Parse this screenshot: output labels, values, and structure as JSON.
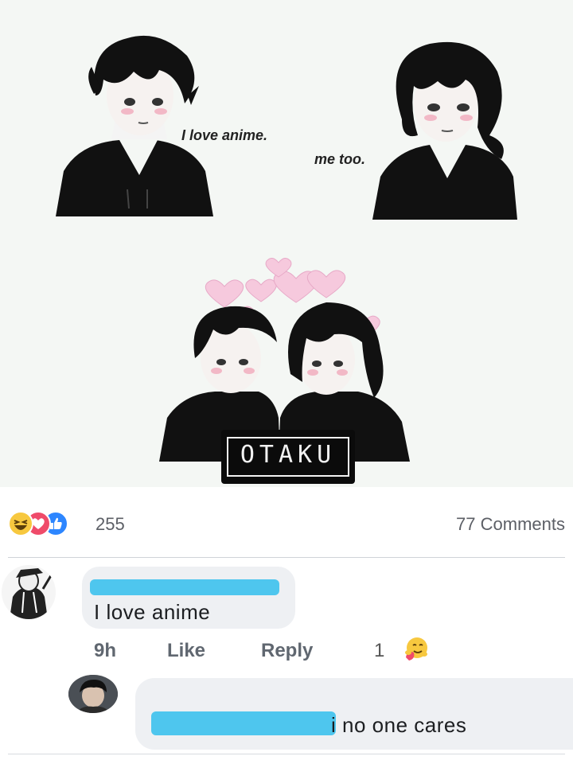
{
  "comic": {
    "speech_left": "I love anime.",
    "speech_right": "me too.",
    "logo_text": "OTAKU"
  },
  "reactions": {
    "icons": [
      "haha-icon",
      "love-icon",
      "like-icon"
    ],
    "count": "255",
    "comments": "77 Comments"
  },
  "comments": [
    {
      "text": "I love anime",
      "time": "9h",
      "like": "Like",
      "reply": "Reply",
      "reaction_count": "1",
      "reaction_icon": "hug-icon"
    },
    {
      "text": "i no one cares"
    }
  ],
  "colors": {
    "redaction": "#4ec6ee",
    "bubble": "#eef0f3",
    "meta_text": "#606770"
  }
}
